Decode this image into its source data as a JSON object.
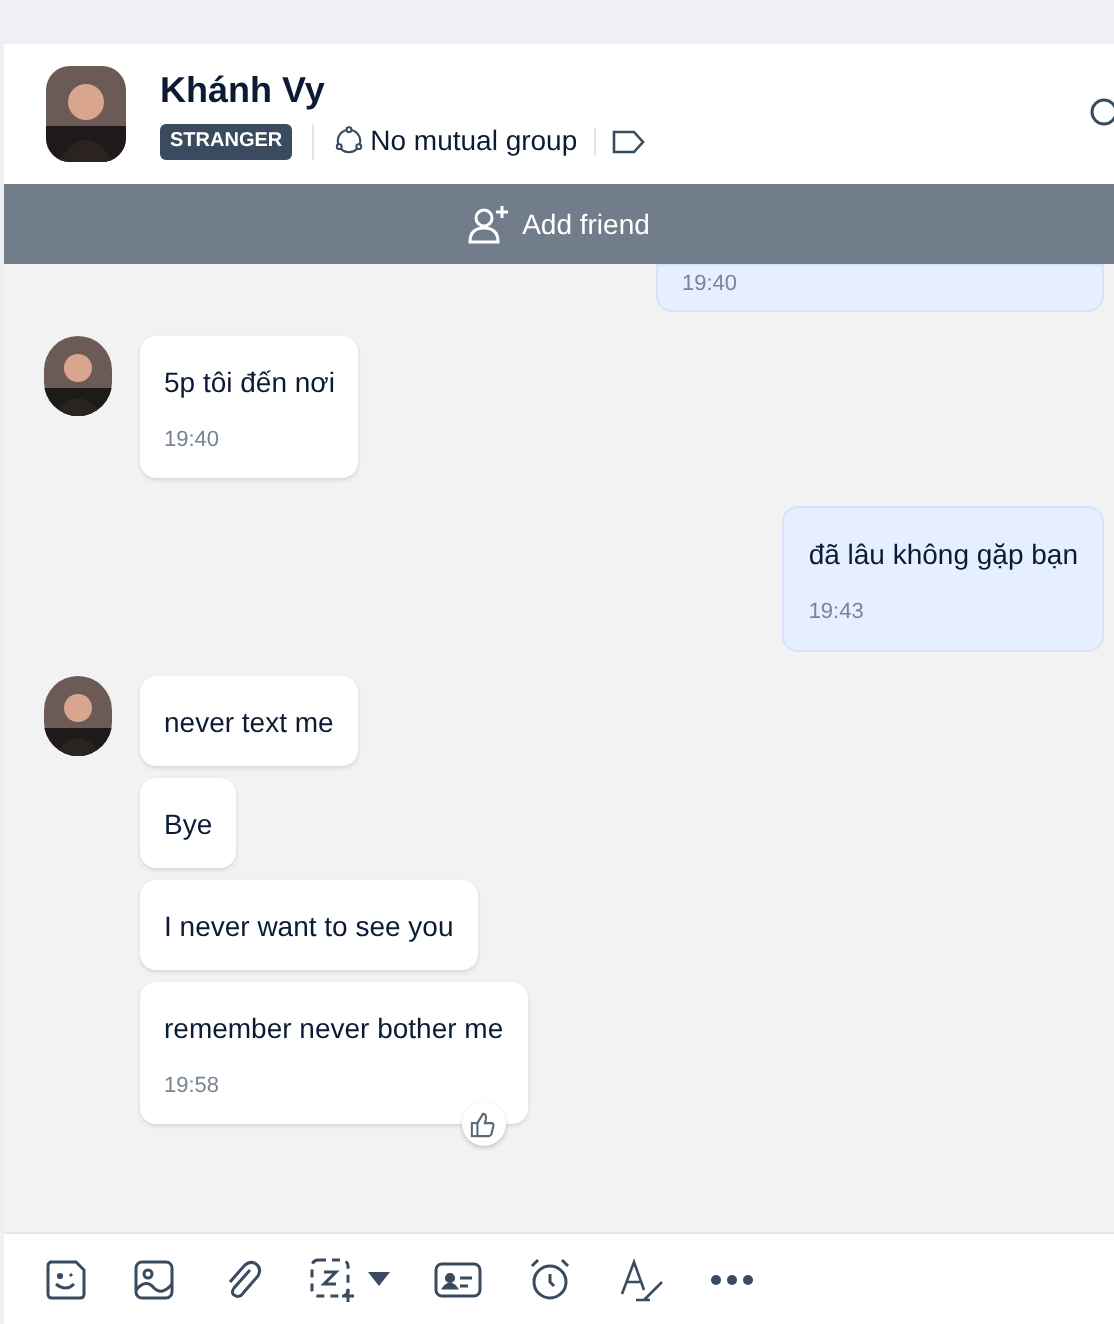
{
  "header": {
    "name": "Khánh Vy",
    "badge": "STRANGER",
    "mutual_group": "No mutual group"
  },
  "add_friend": {
    "label": "Add friend"
  },
  "messages": [
    {
      "kind": "sent",
      "items": [
        {
          "time": "19:40"
        }
      ]
    },
    {
      "kind": "received",
      "items": [
        {
          "text": "5p tôi đến nơi",
          "time": "19:40"
        }
      ]
    },
    {
      "kind": "sent",
      "items": [
        {
          "text": "đã lâu không gặp bạn",
          "time": "19:43"
        }
      ]
    },
    {
      "kind": "received",
      "items": [
        {
          "text": "never text me"
        },
        {
          "text": "Bye"
        },
        {
          "text": "I never want to see you"
        },
        {
          "text": "remember never bother me",
          "time": "19:58",
          "reaction": true
        }
      ]
    }
  ]
}
